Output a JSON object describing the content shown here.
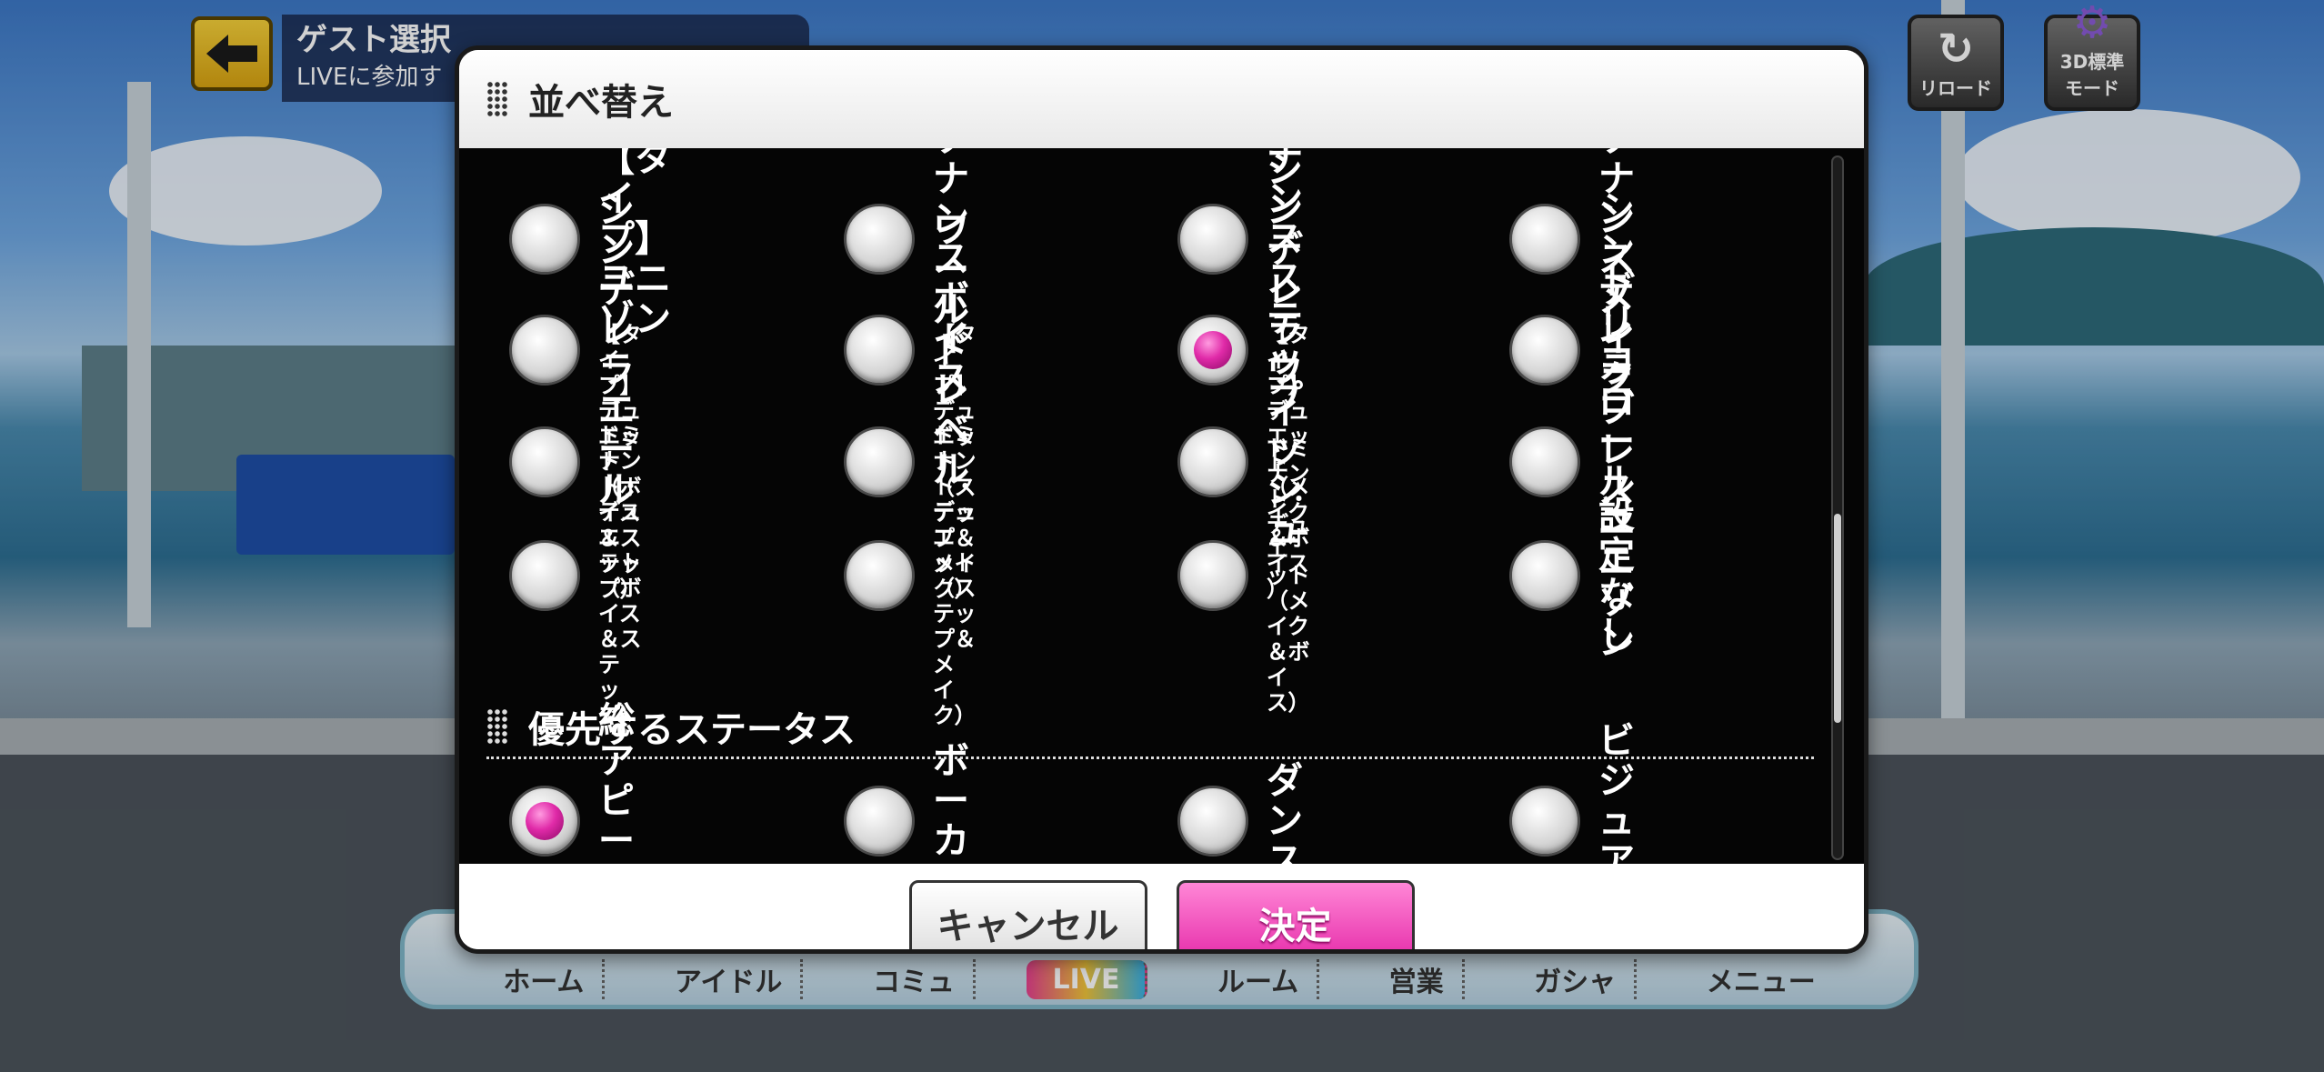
{
  "header": {
    "back_icon": "arrow-left-icon",
    "title": "ゲスト選択",
    "subtitle": "LIVEに参加す"
  },
  "top_right": {
    "reload_label": "リロード",
    "mode_label_1": "3D標準",
    "mode_label_2": "モード"
  },
  "dialog": {
    "title": "並べ替え",
    "options": [
      {
        "label": "【タイプ】\nユニゾン",
        "checked": false
      },
      {
        "label": "レゾナンス\nボイス",
        "checked": false
      },
      {
        "label": "レゾナンス\nステップ",
        "checked": false
      },
      {
        "label": "レゾナンス\nメイク",
        "checked": false
      },
      {
        "label": "シンデレラ\nエール",
        "checked": false
      },
      {
        "label": "ワールド\nレベル",
        "checked": false
      },
      {
        "label": "シンデレラ\nウィッシュ",
        "checked": true
      },
      {
        "label": "シンデレラ\nブレス",
        "checked": false
      },
      {
        "label": "【タイプ】デュエッ\nト（ボイス＆ステッ\nプ）",
        "checked": false
      },
      {
        "label": "【タイプ】デュエッ\nト（ステップ＆メイ\nク）",
        "checked": false
      },
      {
        "label": "【タイプ】デュエッ\nト（メイク＆ボイス\n）",
        "checked": false
      },
      {
        "label": "トリコロール\nユニゾン",
        "checked": false
      },
      {
        "label": "ドミナント・デュエ\nット（ボイス＆ステ\nップ）",
        "checked": false
      },
      {
        "label": "ドミナント・デュエ\nット（ステップ＆メ\nイク）",
        "checked": false
      },
      {
        "label": "ドミナント・デュエ\nット（メイク＆ボイ\nス）",
        "checked": false
      },
      {
        "label": "設定なし",
        "checked": false
      }
    ],
    "priority_section_title": "優先するステータス",
    "priority_options": [
      {
        "label": "総アピール値",
        "checked": true
      },
      {
        "label": "ボーカル",
        "checked": false
      },
      {
        "label": "ダンス",
        "checked": false
      },
      {
        "label": "ビジュアル",
        "checked": false
      }
    ],
    "cancel_label": "キャンセル",
    "confirm_label": "決定"
  },
  "bottom_nav": [
    "ホーム",
    "アイドル",
    "コミュ",
    "LIVE",
    "ルーム",
    "営業",
    "ガシャ",
    "メニュー"
  ],
  "colors": {
    "radio_checked": "#e02aa8",
    "confirm_button": "#e52aa8",
    "dialog_body": "#050505"
  }
}
